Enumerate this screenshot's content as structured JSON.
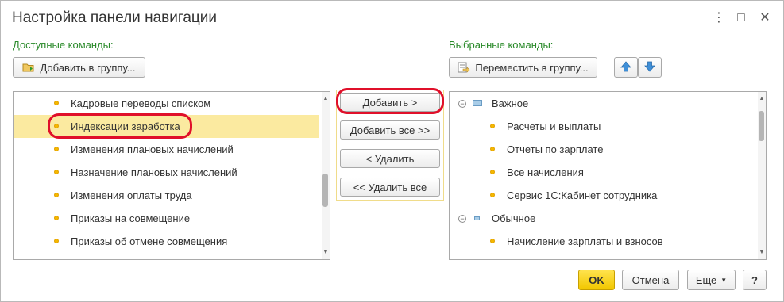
{
  "window": {
    "title": "Настройка панели навигации",
    "more_icon": "⋮",
    "maximize_icon": "□",
    "close_icon": "✕"
  },
  "available": {
    "label": "Доступные команды:",
    "add_to_group_label": "Добавить в группу...",
    "items": [
      {
        "label": "Кадровые переводы списком"
      },
      {
        "label": "Индексации заработка"
      },
      {
        "label": "Изменения плановых начислений"
      },
      {
        "label": "Назначение плановых начислений"
      },
      {
        "label": "Изменения оплаты труда"
      },
      {
        "label": "Приказы на совмещение"
      },
      {
        "label": "Приказы об отмене совмещения"
      }
    ]
  },
  "selected": {
    "label": "Выбранные команды:",
    "move_to_group_label": "Переместить в группу...",
    "groups": [
      {
        "label": "Важное",
        "items": [
          "Расчеты и выплаты",
          "Отчеты по зарплате",
          "Все начисления",
          "Сервис 1С:Кабинет сотрудника"
        ]
      },
      {
        "label": "Обычное",
        "items": [
          "Начисление зарплаты и взносов"
        ]
      }
    ]
  },
  "actions": {
    "add": "Добавить >",
    "add_all": "Добавить все >>",
    "remove": "< Удалить",
    "remove_all": "<< Удалить все"
  },
  "footer": {
    "ok": "OK",
    "cancel": "Отмена",
    "more": "Еще",
    "help": "?"
  },
  "colors": {
    "label_green": "#2a8a2a",
    "highlight": "#fbeaa0",
    "annotation_red": "#e0102a",
    "ok_yellow": "#f2c700"
  }
}
